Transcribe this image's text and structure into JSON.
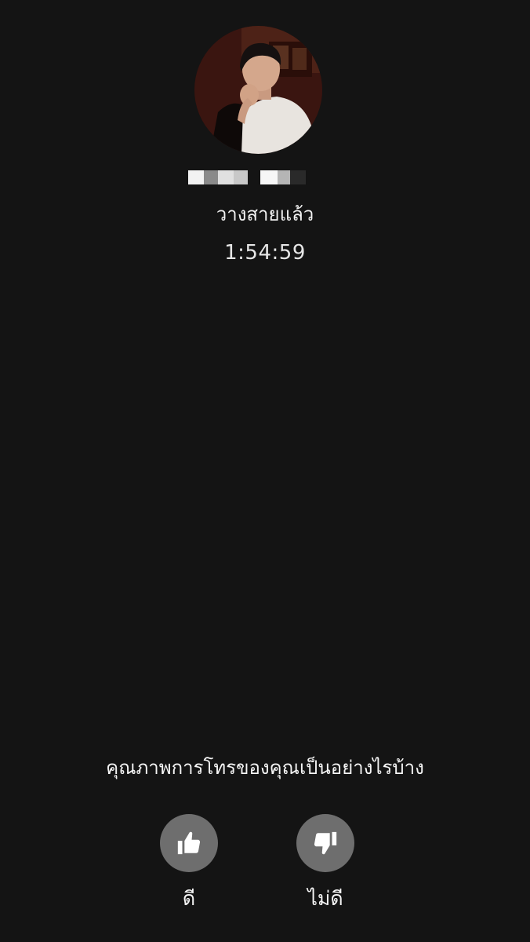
{
  "call": {
    "status": "วางสายแล้ว",
    "duration": "1:54:59"
  },
  "feedback": {
    "question": "คุณภาพการโทรของคุณเป็นอย่างไรบ้าง",
    "good_label": "ดี",
    "good_icon": "thumbs-up-icon",
    "bad_label": "ไม่ดี",
    "bad_icon": "thumbs-down-icon"
  },
  "colors": {
    "background": "#141414",
    "button_circle": "#6e6e6e",
    "text": "#ffffff"
  }
}
